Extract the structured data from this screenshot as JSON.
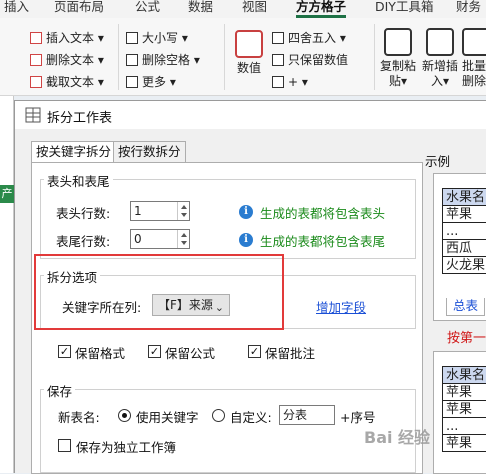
{
  "ribbon": {
    "tabs": [
      "插入",
      "页面布局",
      "公式",
      "数据",
      "视图",
      "方方格子",
      "DIY工具箱",
      "财务"
    ],
    "active_tab": "方方格子",
    "text_group": [
      "插入文本 ▾",
      "删除文本 ▾",
      "截取文本 ▾"
    ],
    "case_group": [
      "大小写 ▾",
      "删除空格 ▾",
      "更多 ▾"
    ],
    "numeric_big": "数值",
    "numeric_items": [
      "四舍五入 ▾",
      "只保留数值",
      "+ ▾"
    ],
    "copy_paste": "复制粘贴▾",
    "insert": "新增插入▾",
    "batch_delete": "批量删除"
  },
  "sheet": {
    "green_cell_text": "产"
  },
  "dialog": {
    "title": "拆分工作表",
    "tabs": [
      "按关键字拆分",
      "按行数拆分"
    ],
    "header_group": {
      "label": "表头和表尾",
      "header_rows_label": "表头行数:",
      "header_rows_value": "1",
      "header_hint": "生成的表都将包含表头",
      "footer_rows_label": "表尾行数:",
      "footer_rows_value": "0",
      "footer_hint": "生成的表都将包含表尾"
    },
    "split_group": {
      "label": "拆分选项",
      "key_col_label": "关键字所在列:",
      "key_col_value": "【F】来源",
      "add_field": "增加字段"
    },
    "options": [
      "保留格式",
      "保留公式",
      "保留批注"
    ],
    "save_group": {
      "label": "保存",
      "new_name_label": "新表名:",
      "radio_keyword": "使用关键字",
      "radio_custom": "自定义:",
      "custom_value": "分表",
      "suffix": "+序号",
      "independent": "保存为独立工作簿"
    },
    "example": {
      "label": "示例",
      "table1": [
        "水果名",
        "苹果",
        "...",
        "西瓜",
        "火龙果"
      ],
      "sheet_tab": "总表",
      "red_text": "按第一",
      "table2": [
        "水果名",
        "苹果",
        "苹果",
        "...",
        "苹果"
      ]
    }
  },
  "watermark": "Bai 经验",
  "colors": {
    "accent_green": "#1e7145",
    "highlight_red": "#e23a3a",
    "link_blue": "#1a4fd6",
    "hint_green": "#1a8a1a"
  }
}
